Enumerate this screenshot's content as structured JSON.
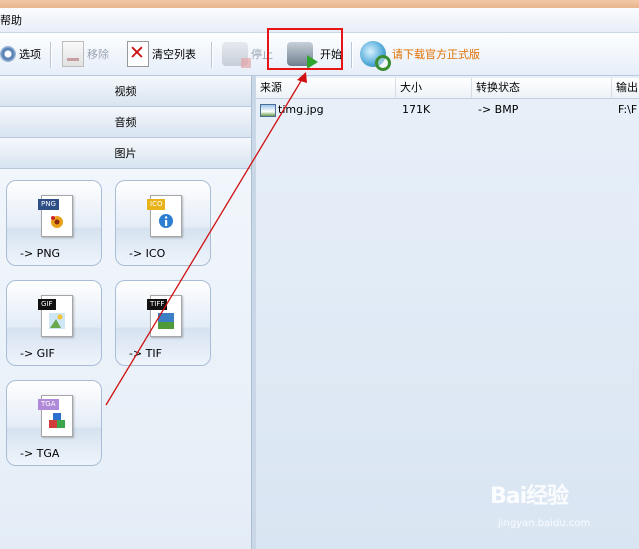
{
  "menubar": {
    "help": "帮助"
  },
  "toolbar": {
    "options": "选项",
    "remove": "移除",
    "clear_list": "清空列表",
    "stop": "停止",
    "start": "开始",
    "download_official": "请下载官方正式版"
  },
  "sidebar": {
    "categories": [
      "视频",
      "音频",
      "图片"
    ],
    "formats": [
      {
        "tag": "PNG",
        "label": "-> PNG"
      },
      {
        "tag": "ICO",
        "label": "-> ICO"
      },
      {
        "tag": "GIF",
        "label": "-> GIF"
      },
      {
        "tag": "TIFF",
        "label": "-> TIF"
      },
      {
        "tag": "TGA",
        "label": "-> TGA"
      }
    ]
  },
  "file_list": {
    "columns": [
      "来源",
      "大小",
      "转换状态",
      "输出"
    ],
    "rows": [
      {
        "source": "timg.jpg",
        "size": "171K",
        "status": "-> BMP",
        "output": "F:\\F"
      }
    ]
  },
  "watermark": {
    "brand": "Bai经验",
    "url": "jingyan.baidu.com"
  },
  "colors": {
    "highlight": "#e61414",
    "annotation_arrow": "#d01010",
    "promo_text": "#e06f00"
  }
}
